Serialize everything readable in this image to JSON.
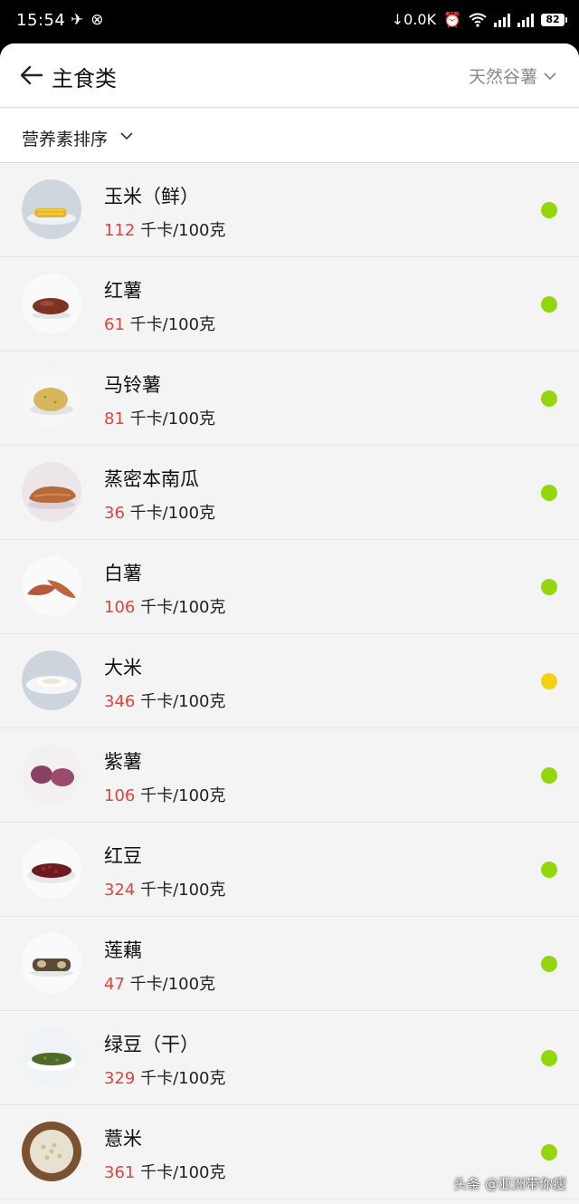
{
  "status_bar": {
    "time": "15:54",
    "left_icons": [
      "notification-icon",
      "network-icon"
    ],
    "net_speed": "↓0.0K",
    "battery": "82"
  },
  "header": {
    "title": "主食类",
    "category_label": "天然谷薯"
  },
  "sort": {
    "label": "营养素排序"
  },
  "unit": "千卡/100克",
  "colors": {
    "green": "#93d70a",
    "yellow": "#f5d20f",
    "calorie_red": "#e0453d"
  },
  "foods": [
    {
      "name": "玉米（鲜）",
      "calories": "112",
      "dot": "green",
      "icon": "corn-icon"
    },
    {
      "name": "红薯",
      "calories": "61",
      "dot": "green",
      "icon": "sweet-potato-icon"
    },
    {
      "name": "马铃薯",
      "calories": "81",
      "dot": "green",
      "icon": "potato-icon"
    },
    {
      "name": "蒸密本南瓜",
      "calories": "36",
      "dot": "green",
      "icon": "pumpkin-icon"
    },
    {
      "name": "白薯",
      "calories": "106",
      "dot": "green",
      "icon": "white-potato-icon"
    },
    {
      "name": "大米",
      "calories": "346",
      "dot": "yellow",
      "icon": "rice-icon"
    },
    {
      "name": "紫薯",
      "calories": "106",
      "dot": "green",
      "icon": "purple-potato-icon"
    },
    {
      "name": "红豆",
      "calories": "324",
      "dot": "green",
      "icon": "red-bean-icon"
    },
    {
      "name": "莲藕",
      "calories": "47",
      "dot": "green",
      "icon": "lotus-root-icon"
    },
    {
      "name": "绿豆（干）",
      "calories": "329",
      "dot": "green",
      "icon": "mung-bean-icon"
    },
    {
      "name": "薏米",
      "calories": "361",
      "dot": "green",
      "icon": "barley-icon"
    }
  ],
  "watermark": "头条 @亚洲带你瘦"
}
